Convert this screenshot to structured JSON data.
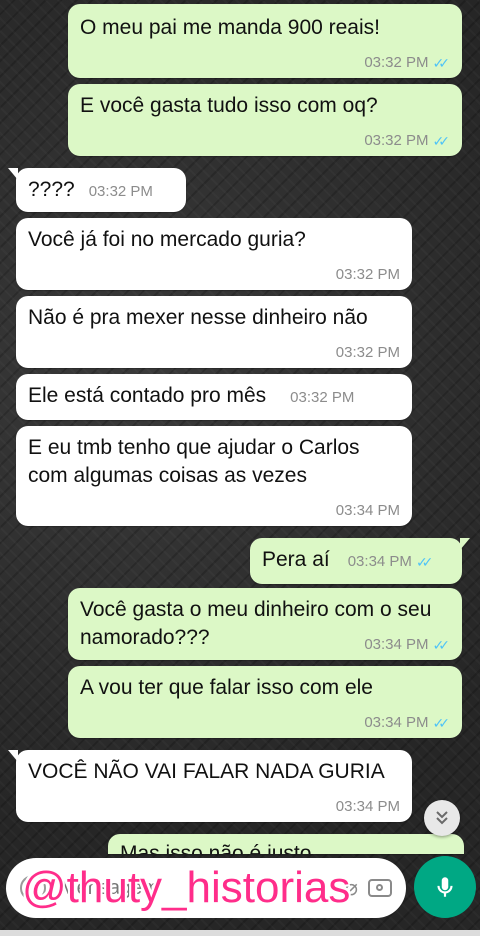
{
  "messages": [
    {
      "dir": "out",
      "text": "O meu pai me manda 900 reais!",
      "time": "03:32 PM",
      "ticks": "✓✓"
    },
    {
      "dir": "out",
      "text": "E você gasta tudo isso com oq?",
      "time": "03:32 PM",
      "ticks": "✓✓"
    },
    {
      "dir": "in",
      "text": "????",
      "time": "03:32 PM"
    },
    {
      "dir": "in",
      "text": "Você já foi no mercado guria?",
      "time": "03:32 PM"
    },
    {
      "dir": "in",
      "text": "Não é pra mexer nesse dinheiro não",
      "time": "03:32 PM"
    },
    {
      "dir": "in",
      "text": "Ele está contado pro mês",
      "time": "03:32 PM"
    },
    {
      "dir": "in",
      "text": "E eu tmb tenho que ajudar o Carlos com algumas coisas as vezes",
      "time": "03:34 PM"
    },
    {
      "dir": "out",
      "text": "Pera aí",
      "time": "03:34 PM",
      "ticks": "✓✓"
    },
    {
      "dir": "out",
      "text": "Você gasta o meu dinheiro com o seu namorado???",
      "time": "03:34 PM",
      "ticks": "✓✓"
    },
    {
      "dir": "out",
      "text": "A vou ter que falar isso com ele",
      "time": "03:34 PM",
      "ticks": "✓✓"
    },
    {
      "dir": "in",
      "text": "VOCÊ NÃO VAI FALAR NADA GURIA",
      "time": "03:34 PM"
    },
    {
      "dir": "out",
      "text": "Mas isso não é justo",
      "partial": true
    }
  ],
  "composer": {
    "placeholder": "Mensagem"
  },
  "watermark": {
    "text": "@thuty_historias",
    "top_text": "@thuty_historias"
  },
  "icons": {
    "emoji": "emoji-icon",
    "attach": "paperclip-icon",
    "camera": "camera-icon",
    "mic": "mic-icon",
    "scroll": "chevron-double-down-icon"
  },
  "colors": {
    "outgoing": "#dcf8c6",
    "incoming": "#ffffff",
    "mic": "#00a884",
    "ticks": "#4fc3f7",
    "watermark": "#ff2d8a"
  }
}
